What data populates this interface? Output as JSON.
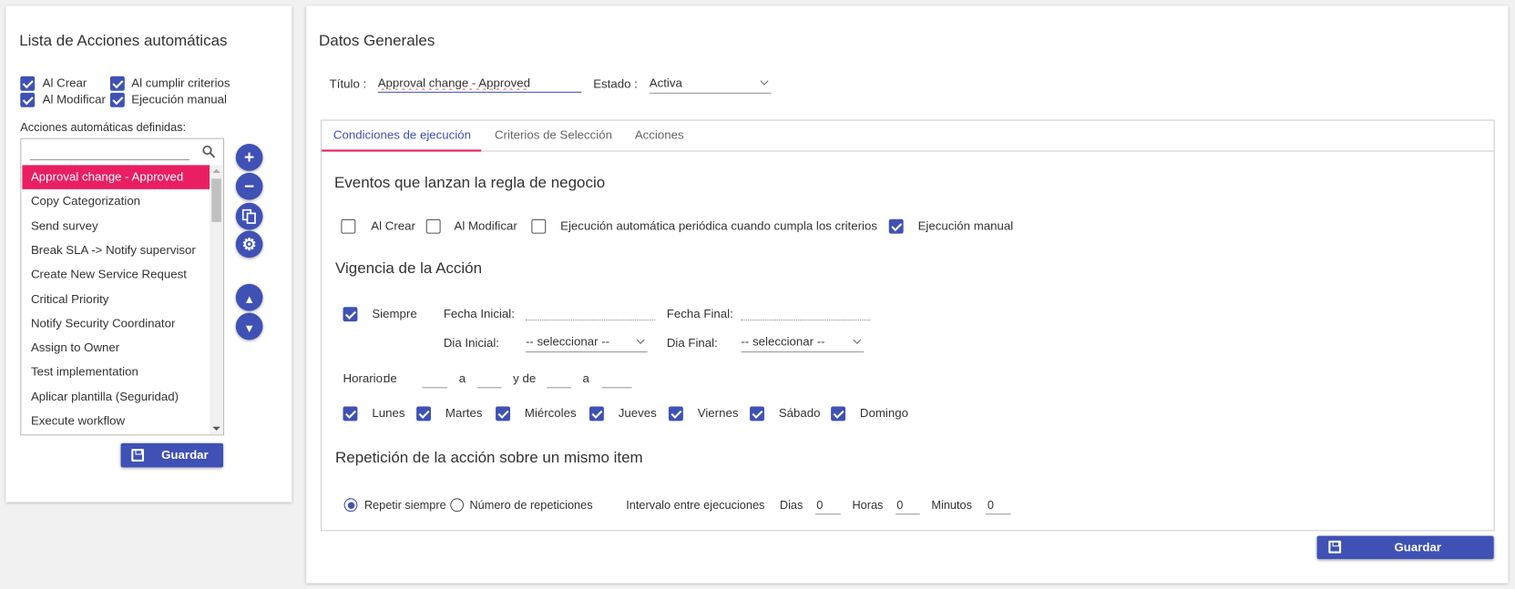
{
  "left_panel": {
    "title": "Lista de Acciones automáticas",
    "filters": [
      {
        "label": "Al Crear",
        "checked": true
      },
      {
        "label": "Al cumplir criterios",
        "checked": true
      },
      {
        "label": "Al Modificar",
        "checked": true
      },
      {
        "label": "Ejecución manual",
        "checked": true
      }
    ],
    "list_label": "Acciones automáticas definidas:",
    "search_value": "",
    "items": [
      "Approval change - Approved",
      "Copy Categorization",
      "Send survey",
      "Break SLA -> Notify supervisor",
      "Create New Service Request",
      "Critical Priority",
      "Notify Security Coordinator",
      "Assign to Owner",
      "Test implementation",
      "Aplicar plantilla (Seguridad)",
      "Execute workflow"
    ],
    "selected_index": 0,
    "save_label": "Guardar"
  },
  "main": {
    "title": "Datos Generales",
    "titulo_label": "Título :",
    "titulo_value": "Approval change - Approved",
    "estado_label": "Estado :",
    "estado_value": "Activa",
    "tabs": [
      "Condiciones de ejecución",
      "Criterios de Selección",
      "Acciones"
    ],
    "active_tab": 0,
    "eventos": {
      "heading": "Eventos que lanzan la regla de negocio",
      "options": [
        {
          "label": "Al Crear",
          "checked": false
        },
        {
          "label": "Al Modificar",
          "checked": false
        },
        {
          "label": "Ejecución automática periódica cuando cumpla los criterios",
          "checked": false
        },
        {
          "label": "Ejecución manual",
          "checked": true
        }
      ]
    },
    "vigencia": {
      "heading": "Vigencia de la Acción",
      "siempre_label": "Siempre",
      "siempre_checked": true,
      "fecha_inicial_label": "Fecha Inicial:",
      "fecha_final_label": "Fecha Final:",
      "dia_inicial_label": "Dia Inicial:",
      "dia_inicial_value": "-- seleccionar --",
      "dia_final_label": "Dia Final:",
      "dia_final_value": "-- seleccionar --",
      "horario_label": "Horario:",
      "de_label": "de",
      "a_label": "a",
      "y_de_label": "y de",
      "a2_label": "a",
      "days": [
        {
          "label": "Lunes",
          "checked": true
        },
        {
          "label": "Martes",
          "checked": true
        },
        {
          "label": "Miércoles",
          "checked": true
        },
        {
          "label": "Jueves",
          "checked": true
        },
        {
          "label": "Viernes",
          "checked": true
        },
        {
          "label": "Sábado",
          "checked": true
        },
        {
          "label": "Domingo",
          "checked": true
        }
      ]
    },
    "repeticion": {
      "heading": "Repetición de la acción sobre un mismo item",
      "repetir_siempre": "Repetir siempre",
      "numero_repeticiones": "Número de repeticiones",
      "selected": "Repetir siempre",
      "intervalo_label": "Intervalo entre ejecuciones",
      "dias_label": "Dias",
      "dias_value": "0",
      "horas_label": "Horas",
      "horas_value": "0",
      "minutos_label": "Minutos",
      "minutos_value": "0"
    },
    "save_label": "Guardar"
  },
  "colors": {
    "primary": "#3f51b5",
    "accent": "#e91e63"
  }
}
